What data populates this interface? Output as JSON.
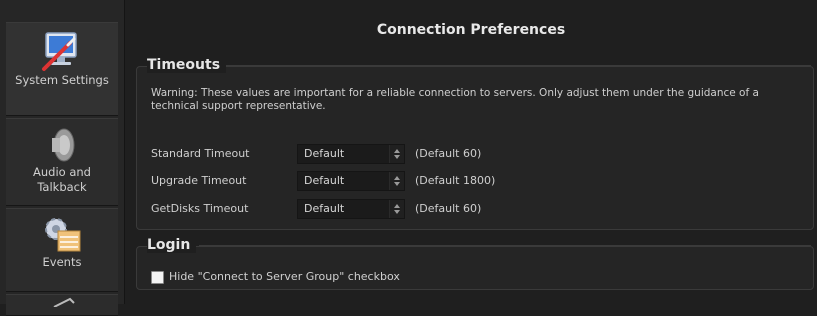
{
  "page": {
    "title": "Connection Preferences"
  },
  "sidebar": {
    "items": [
      {
        "label": "System Settings",
        "icon": "monitor-settings-icon"
      },
      {
        "label": "Audio and Talkback",
        "icon": "speaker-icon"
      },
      {
        "label": "Events",
        "icon": "events-gear-icon"
      },
      {
        "label": "",
        "icon": "partial-icon"
      }
    ]
  },
  "timeouts": {
    "title": "Timeouts",
    "warning": "Warning: These values are important for a reliable connection to servers. Only adjust them under the guidance of a technical support representative.",
    "rows": [
      {
        "label": "Standard Timeout",
        "value": "Default",
        "default": "(Default 60)"
      },
      {
        "label": "Upgrade Timeout",
        "value": "Default",
        "default": "(Default 1800)"
      },
      {
        "label": "GetDisks Timeout",
        "value": "Default",
        "default": "(Default 60)"
      }
    ]
  },
  "login": {
    "title": "Login",
    "checkbox_label": "Hide \"Connect to Server Group\" checkbox",
    "checkbox_checked": false
  }
}
